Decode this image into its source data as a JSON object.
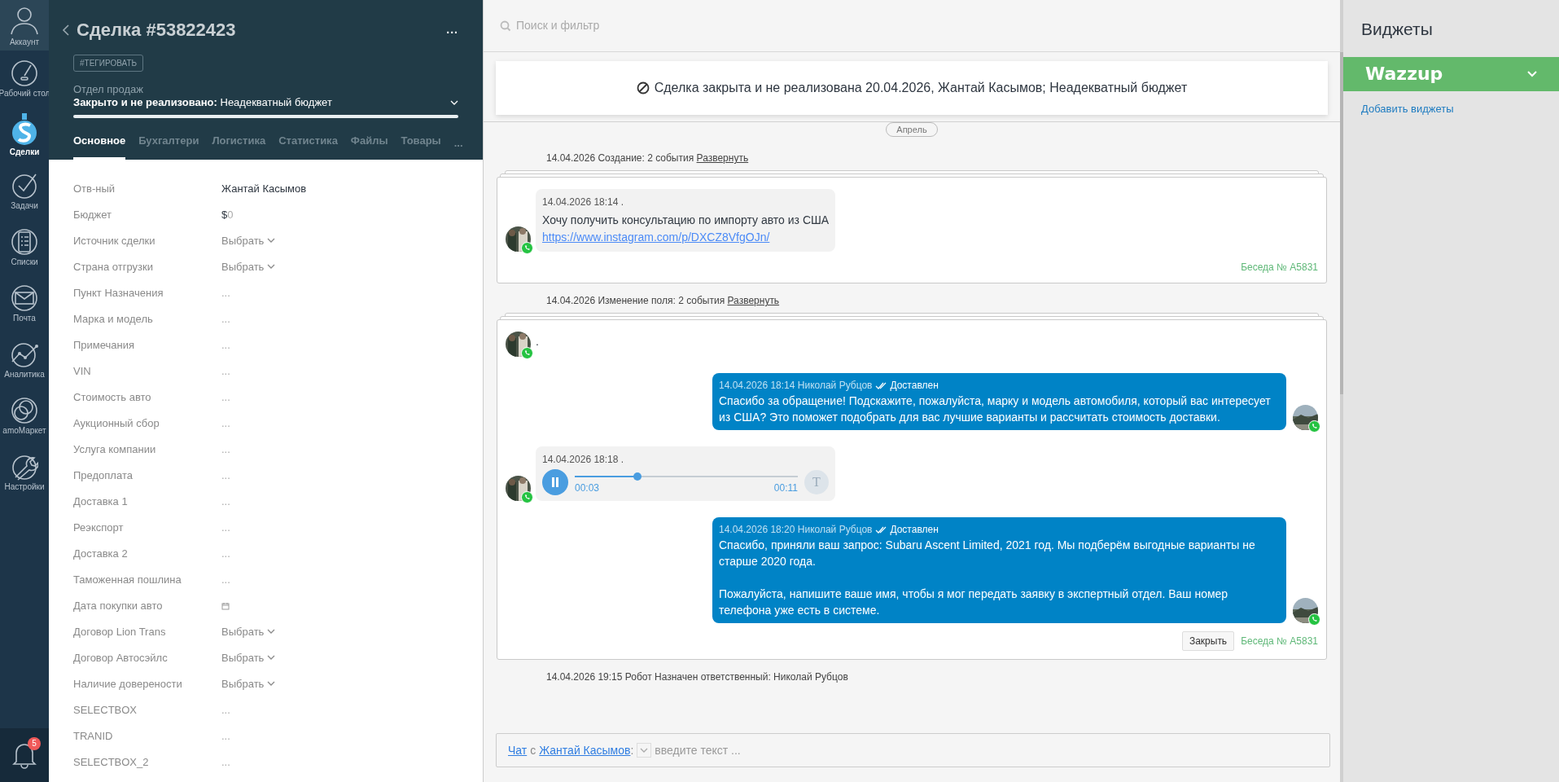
{
  "nav": {
    "items": [
      {
        "label": "Аккаунт",
        "selected": false
      },
      {
        "label": "Рабочий стол",
        "selected": false
      },
      {
        "label": "Сделки",
        "selected": true
      },
      {
        "label": "Задачи",
        "selected": false
      },
      {
        "label": "Списки",
        "selected": false
      },
      {
        "label": "Почта",
        "selected": false
      },
      {
        "label": "Аналитика",
        "selected": false
      },
      {
        "label": "amoМаркет",
        "selected": false
      },
      {
        "label": "Настройки",
        "selected": false
      }
    ],
    "notifications": {
      "badge": "5"
    }
  },
  "deal": {
    "title": "Сделка #53822423",
    "more": "...",
    "tag_button": "#ТЕГИРОВАТЬ",
    "pipeline": "Отдел продаж",
    "status": "**Закрыто и не реализовано:** Неадекватный бюджет",
    "tabs": [
      {
        "label": "Основное",
        "selected": true
      },
      {
        "label": "Бухгалтери",
        "selected": false
      },
      {
        "label": "Логистика",
        "selected": false
      },
      {
        "label": "Статистика",
        "selected": false
      },
      {
        "label": "Файлы",
        "selected": false
      },
      {
        "label": "Товары",
        "selected": false
      }
    ],
    "tabs_more": "...",
    "fields": [
      {
        "label": "Отв-ный",
        "kind": "text",
        "value": "Жантай Касымов"
      },
      {
        "label": "Бюджет",
        "kind": "money",
        "currency": "$",
        "value": "0"
      },
      {
        "label": "Источник сделки",
        "kind": "select",
        "value": "Выбрать"
      },
      {
        "label": "Страна отгрузки",
        "kind": "select",
        "value": "Выбрать"
      },
      {
        "label": "Пункт Назначения",
        "kind": "empty",
        "value": "..."
      },
      {
        "label": "Марка и модель",
        "kind": "empty",
        "value": "..."
      },
      {
        "label": "Примечания",
        "kind": "empty",
        "value": "..."
      },
      {
        "label": "VIN",
        "kind": "empty",
        "value": "..."
      },
      {
        "label": "Стоимость авто",
        "kind": "empty",
        "value": "..."
      },
      {
        "label": "Аукционный сбор",
        "kind": "empty",
        "value": "..."
      },
      {
        "label": "Услуга компании",
        "kind": "empty",
        "value": "..."
      },
      {
        "label": "Предоплата",
        "kind": "empty",
        "value": "..."
      },
      {
        "label": "Доставка 1",
        "kind": "empty",
        "value": "..."
      },
      {
        "label": "Реэкспорт",
        "kind": "empty",
        "value": "..."
      },
      {
        "label": "Доставка 2",
        "kind": "empty",
        "value": "..."
      },
      {
        "label": "Таможенная пошлина",
        "kind": "empty",
        "value": "..."
      },
      {
        "label": "Дата покупки авто",
        "kind": "date"
      },
      {
        "label": "Договор Lion Trans",
        "kind": "select",
        "value": "Выбрать"
      },
      {
        "label": "Договор Автосэйлс",
        "kind": "select",
        "value": "Выбрать"
      },
      {
        "label": "Наличие доверености",
        "kind": "select",
        "value": "Выбрать"
      },
      {
        "label": "SELECTBOX",
        "kind": "empty",
        "value": "..."
      },
      {
        "label": "TRANID",
        "kind": "empty",
        "value": "..."
      },
      {
        "label": "SELECTBOX_2",
        "kind": "empty",
        "value": "..."
      }
    ]
  },
  "feed": {
    "search_placeholder": "Поиск и фильтр",
    "closed_banner": "Сделка закрыта и не реализована 20.04.2026, Жантай Касымов; Неадекватный бюджет",
    "month": "Апрель",
    "entries": [
      {
        "kind": "note",
        "text": "14.04.2026 Создание: 2 события",
        "link": "Развернуть"
      },
      {
        "kind": "chat",
        "conversation": "Беседа № A5831",
        "messages": [
          {
            "kind": "incoming",
            "meta": "14.04.2026 18:14 .",
            "text": "Хочу получить консультацию по импорту авто из США",
            "link": "https://www.instagram.com/p/DXCZ8VfgOJn/"
          }
        ]
      },
      {
        "kind": "note",
        "text": "14.04.2026 Изменение поля: 2 события",
        "link": "Развернуть"
      },
      {
        "kind": "chat",
        "close_button": "Закрыть",
        "conversation": "Беседа № A5831",
        "messages": [
          {
            "kind": "incoming",
            "text": "."
          },
          {
            "kind": "outgoing",
            "meta": "14.04.2026 18:14 Николай Рубцов",
            "status": "Доставлен",
            "text": "Спасибо за обращение! Подскажите, пожалуйста, марку и модель автомобиля, который вас интересует из США? Это поможет подобрать для вас лучшие варианты и рассчитать стоимость доставки."
          },
          {
            "kind": "voice",
            "meta": "14.04.2026 18:18 .",
            "elapsed": "00:03",
            "duration": "00:11",
            "level": 0.28,
            "transcribe": "T"
          },
          {
            "kind": "outgoing",
            "meta": "14.04.2026 18:20 Николай Рубцов",
            "status": "Доставлен",
            "text": "Спасибо, приняли ваш запрос: Subaru Ascent Limited, 2021 год. Мы подберём выгодные варианты не старше 2020 года.\n\nПожалуйста, напишите ваше имя, чтобы я мог передать заявку в экспертный отдел. Ваш номер телефона уже есть в системе."
          }
        ]
      },
      {
        "kind": "note",
        "text": "14.04.2026 19:15 Робот Назначен ответственный: Николай Рубцов"
      }
    ],
    "composer": {
      "chat_link": "Чат",
      "with": "с",
      "contact": "Жантай Касымов",
      "colon": ":",
      "placeholder": "введите текст ..."
    }
  },
  "widgets": {
    "title": "Виджеты",
    "items": [
      {
        "name": "Wazzup",
        "expanded": false
      }
    ],
    "add_link": "Добавить виджеты"
  }
}
